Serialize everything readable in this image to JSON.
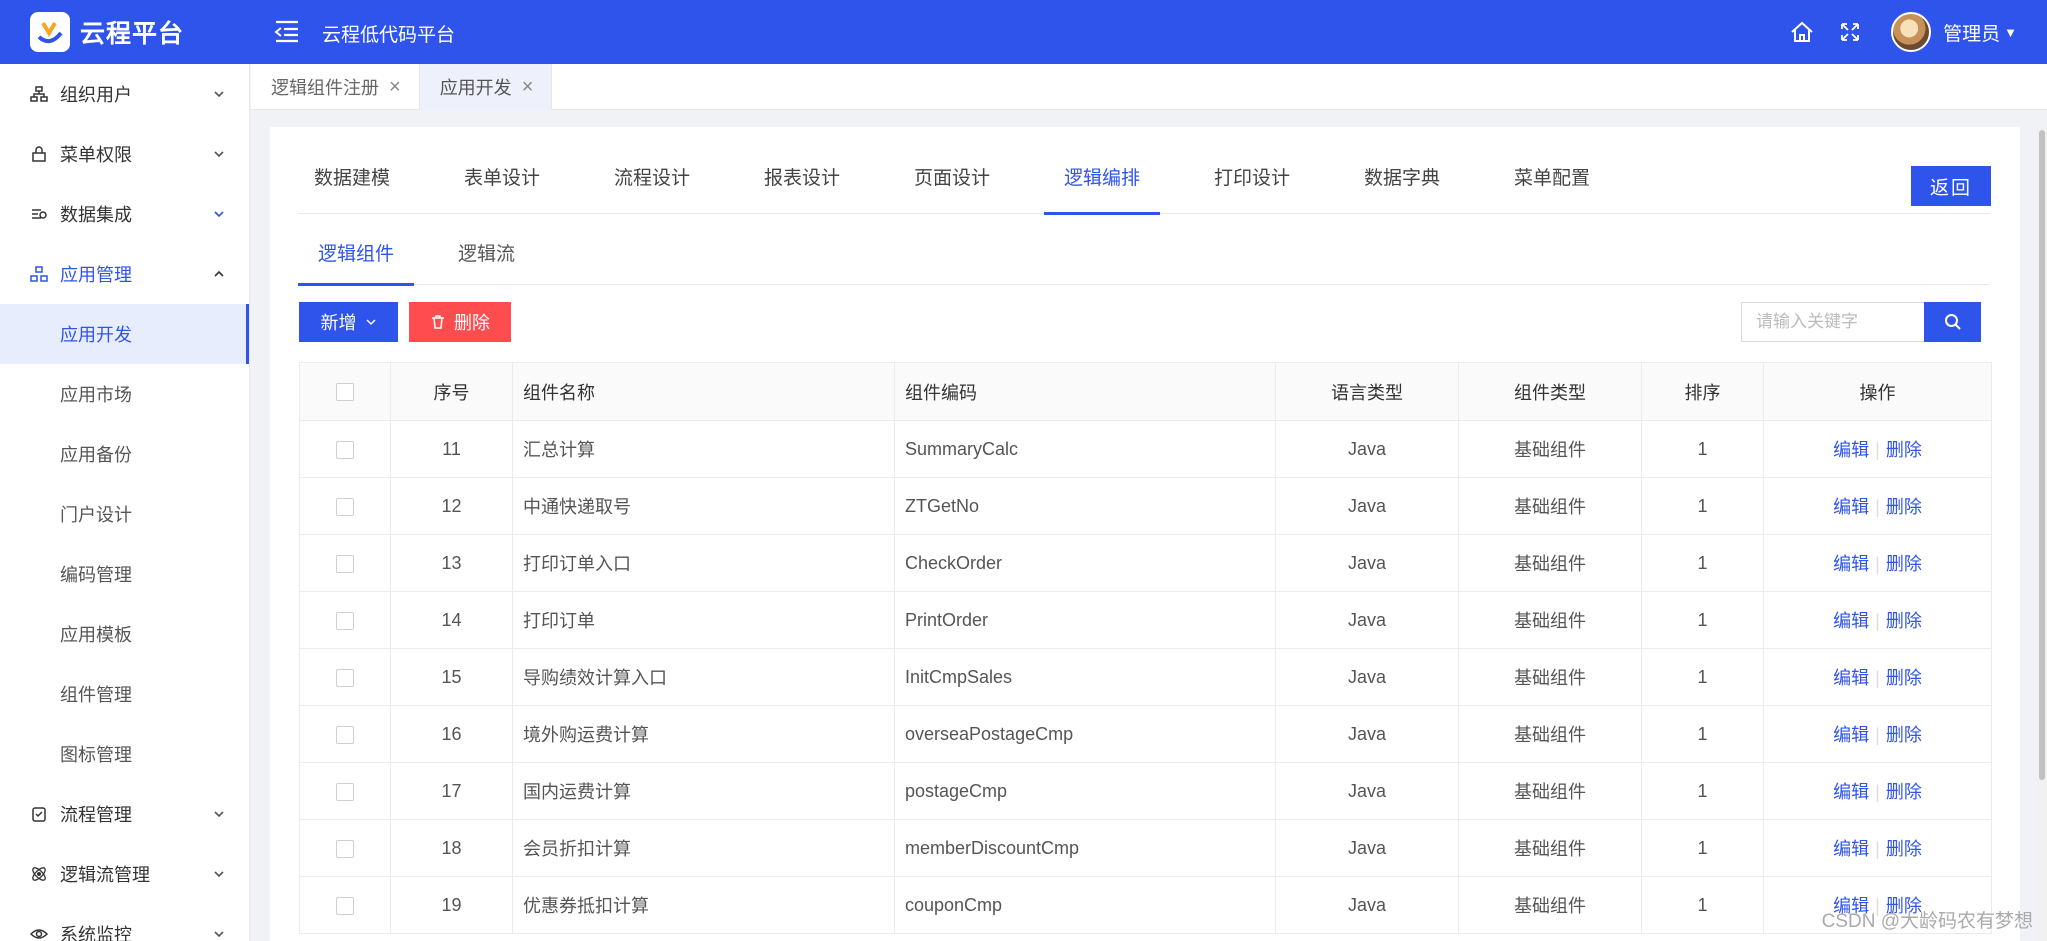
{
  "header": {
    "brand": "云程平台",
    "app_title": "云程低代码平台",
    "user_name": "管理员",
    "brand_color": "#2f54eb"
  },
  "sidebar": {
    "items": [
      {
        "label": "组织用户",
        "icon": "org-icon"
      },
      {
        "label": "菜单权限",
        "icon": "lock-icon"
      },
      {
        "label": "数据集成",
        "icon": "data-icon"
      },
      {
        "label": "应用管理",
        "icon": "app-icon"
      },
      {
        "label": "流程管理",
        "icon": "flow-icon"
      },
      {
        "label": "逻辑流管理",
        "icon": "logic-icon"
      },
      {
        "label": "系统监控",
        "icon": "eye-icon"
      }
    ],
    "sub_items": [
      "应用开发",
      "应用市场",
      "应用备份",
      "门户设计",
      "编码管理",
      "应用模板",
      "组件管理",
      "图标管理"
    ]
  },
  "page_tabs": [
    {
      "label": "逻辑组件注册"
    },
    {
      "label": "应用开发"
    }
  ],
  "main_tabs": [
    "数据建模",
    "表单设计",
    "流程设计",
    "报表设计",
    "页面设计",
    "逻辑编排",
    "打印设计",
    "数据字典",
    "菜单配置"
  ],
  "back_label": "返回",
  "sub_tabs": [
    "逻辑组件",
    "逻辑流"
  ],
  "toolbar": {
    "add_label": "新增",
    "delete_label": "删除",
    "search_placeholder": "请输入关键字"
  },
  "table": {
    "headers": [
      "序号",
      "组件名称",
      "组件编码",
      "语言类型",
      "组件类型",
      "排序",
      "操作"
    ],
    "rows": [
      {
        "no": "11",
        "name": "汇总计算",
        "code": "SummaryCalc",
        "lang": "Java",
        "type": "基础组件",
        "sort": "1"
      },
      {
        "no": "12",
        "name": "中通快递取号",
        "code": "ZTGetNo",
        "lang": "Java",
        "type": "基础组件",
        "sort": "1"
      },
      {
        "no": "13",
        "name": "打印订单入口",
        "code": "CheckOrder",
        "lang": "Java",
        "type": "基础组件",
        "sort": "1"
      },
      {
        "no": "14",
        "name": "打印订单",
        "code": "PrintOrder",
        "lang": "Java",
        "type": "基础组件",
        "sort": "1"
      },
      {
        "no": "15",
        "name": "导购绩效计算入口",
        "code": "InitCmpSales",
        "lang": "Java",
        "type": "基础组件",
        "sort": "1"
      },
      {
        "no": "16",
        "name": "境外购运费计算",
        "code": "overseaPostageCmp",
        "lang": "Java",
        "type": "基础组件",
        "sort": "1"
      },
      {
        "no": "17",
        "name": "国内运费计算",
        "code": "postageCmp",
        "lang": "Java",
        "type": "基础组件",
        "sort": "1"
      },
      {
        "no": "18",
        "name": "会员折扣计算",
        "code": "memberDiscountCmp",
        "lang": "Java",
        "type": "基础组件",
        "sort": "1"
      },
      {
        "no": "19",
        "name": "优惠券抵扣计算",
        "code": "couponCmp",
        "lang": "Java",
        "type": "基础组件",
        "sort": "1"
      }
    ],
    "edit_label": "编辑",
    "delete_label": "删除"
  },
  "watermark": "CSDN @大龄码农有梦想"
}
